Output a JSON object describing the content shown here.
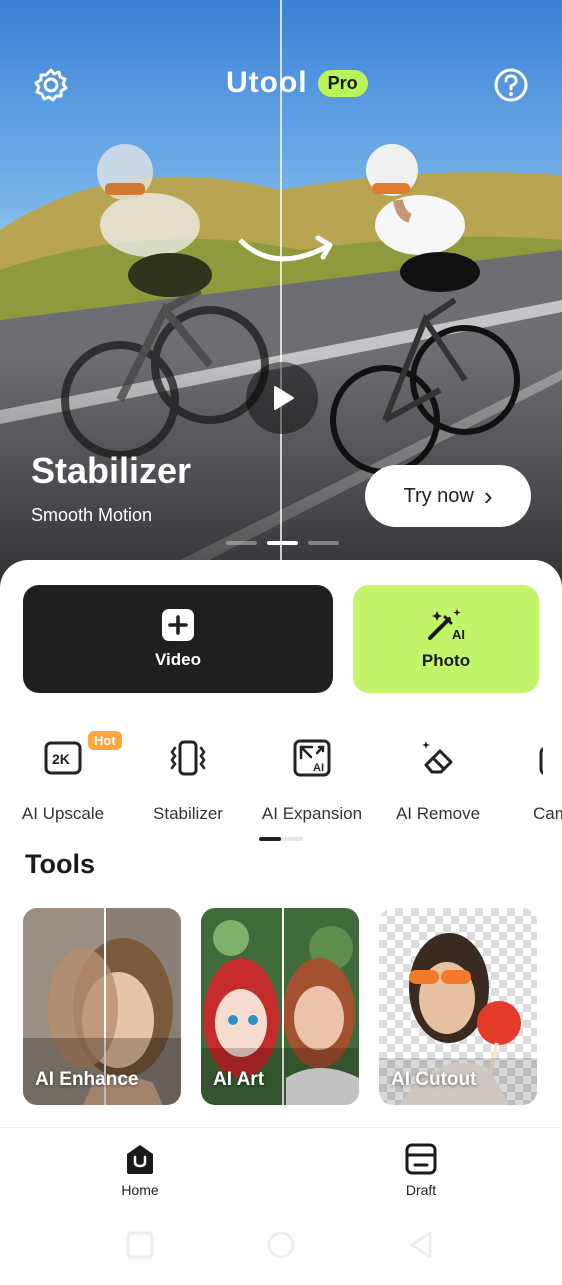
{
  "header": {
    "app_name": "Utool",
    "badge": "Pro"
  },
  "hero": {
    "title": "Stabilizer",
    "subtitle": "Smooth Motion",
    "cta_label": "Try now",
    "cta_chevron": "›",
    "carousel_pages": 3,
    "carousel_active": 2
  },
  "actions": {
    "video_label": "Video",
    "photo_label": "Photo"
  },
  "features": [
    {
      "label": "AI Upscale",
      "icon": "2k-icon"
    },
    {
      "label": "Stabilizer",
      "icon": "stabilizer-icon"
    },
    {
      "label": "AI Expansion",
      "icon": "expand-icon"
    },
    {
      "label": "AI Remove",
      "icon": "eraser-icon"
    },
    {
      "label": "Cam",
      "icon": "camera-icon"
    }
  ],
  "hot_badge": "Hot",
  "upscale_icon_text": "2K",
  "tools": {
    "title": "Tools",
    "items": [
      {
        "label": "AI Enhance"
      },
      {
        "label": "AI Art"
      },
      {
        "label": "AI Cutout"
      }
    ]
  },
  "nav": {
    "items": [
      {
        "label": "Home",
        "icon": "home-icon"
      },
      {
        "label": "Draft",
        "icon": "draft-icon"
      }
    ]
  },
  "colors": {
    "accent_green": "#c2f56a",
    "pro_green": "#b9f55a",
    "hot_orange": "#ffa53a",
    "dark_card": "#1f1f1f"
  }
}
